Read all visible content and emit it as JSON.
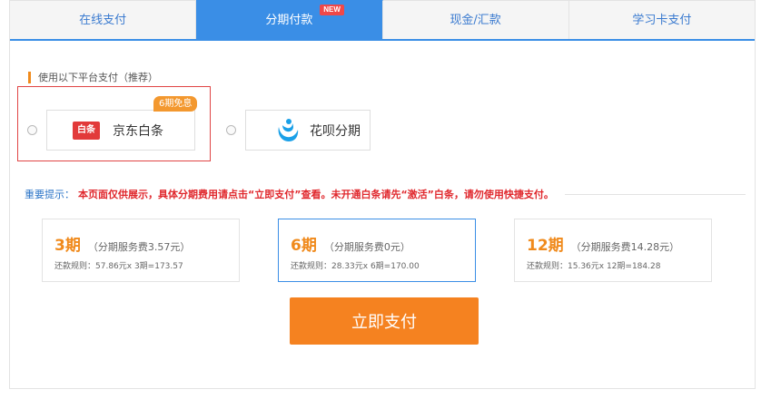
{
  "tabs": [
    {
      "label": "在线支付",
      "active": false
    },
    {
      "label": "分期付款",
      "active": true,
      "badge": "NEW"
    },
    {
      "label": "现金/汇款",
      "active": false
    },
    {
      "label": "学习卡支付",
      "active": false
    }
  ],
  "section_label": "使用以下平台支付（推荐）",
  "platforms": [
    {
      "name": "京东白条",
      "logo_text": "白条",
      "badge": "6期免息",
      "selected": true,
      "color": "#e23a3a"
    },
    {
      "name": "花呗分期",
      "selected": false,
      "color": "#1aa0e8"
    }
  ],
  "notice": {
    "lead": "重要提示：",
    "text": "本页面仅供展示，具体分期费用请点击“立即支付”查看。未开通白条请先“激活”白条，请勿使用快捷支付。"
  },
  "plans": [
    {
      "period": "3期",
      "fee": "（分期服务费3.57元）",
      "rule": "还款规则：57.86元x 3期=173.57",
      "selected": false
    },
    {
      "period": "6期",
      "fee": "（分期服务费0元）",
      "rule": "还款规则：28.33元x 6期=170.00",
      "selected": true
    },
    {
      "period": "12期",
      "fee": "（分期服务费14.28元）",
      "rule": "还款规则：15.36元x 12期=184.28",
      "selected": false
    }
  ],
  "pay_button": "立即支付",
  "colors": {
    "accent_blue": "#3a8ee6",
    "accent_orange": "#f58220",
    "alert_red": "#e0282d"
  }
}
